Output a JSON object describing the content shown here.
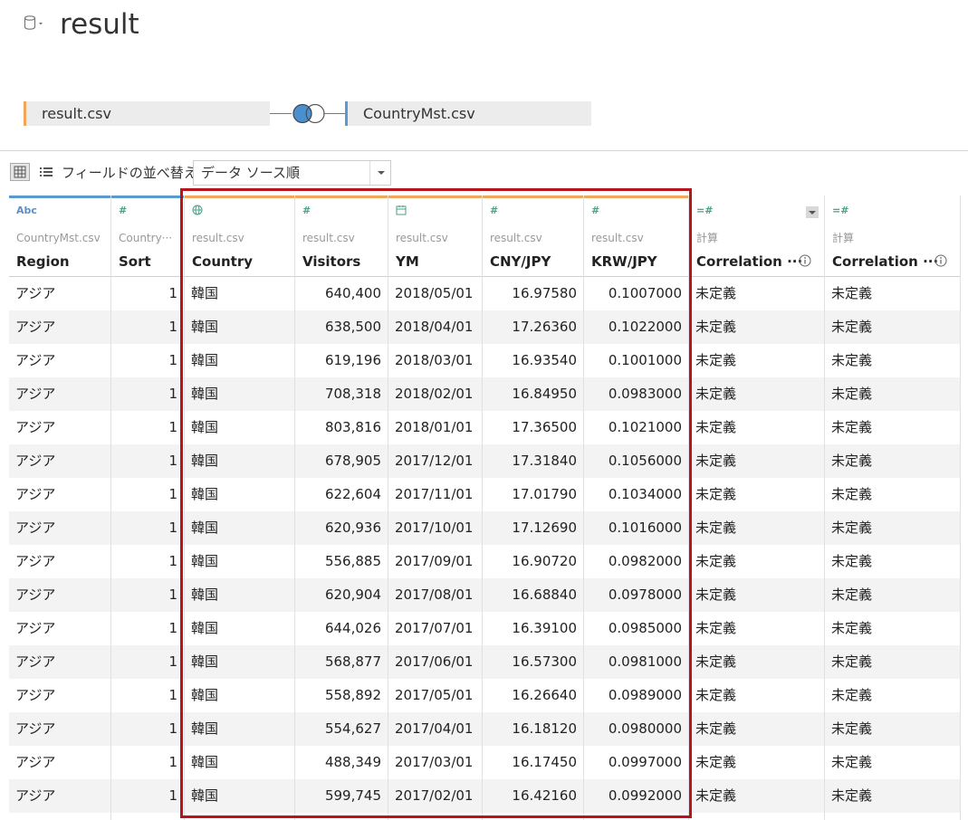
{
  "datasource": {
    "title": "result",
    "icon": "cylinder-db-icon"
  },
  "join": {
    "left_table": "result.csv",
    "right_table": "CountryMst.csv",
    "join_type": "left-join-icon"
  },
  "toolbar": {
    "sort_label": "フィールドの並べ替え",
    "sort_value": "データ ソース順"
  },
  "columns": [
    {
      "type_icon": "Abc",
      "source": "CountryMst.csv",
      "name": "Region"
    },
    {
      "type_icon": "#",
      "source": "Country···",
      "name": "Sort"
    },
    {
      "type_icon": "globe",
      "source": "result.csv",
      "name": "Country"
    },
    {
      "type_icon": "#",
      "source": "result.csv",
      "name": "Visitors"
    },
    {
      "type_icon": "calendar",
      "source": "result.csv",
      "name": "YM"
    },
    {
      "type_icon": "#",
      "source": "result.csv",
      "name": "CNY/JPY"
    },
    {
      "type_icon": "#",
      "source": "result.csv",
      "name": "KRW/JPY"
    },
    {
      "type_icon": "=#",
      "source": "計算",
      "name": "Correlation ···"
    },
    {
      "type_icon": "=#",
      "source": "計算",
      "name": "Correlation ···"
    }
  ],
  "rows": [
    [
      "アジア",
      "1",
      "韓国",
      "640,400",
      "2018/05/01",
      "16.97580",
      "0.1007000",
      "未定義",
      "未定義"
    ],
    [
      "アジア",
      "1",
      "韓国",
      "638,500",
      "2018/04/01",
      "17.26360",
      "0.1022000",
      "未定義",
      "未定義"
    ],
    [
      "アジア",
      "1",
      "韓国",
      "619,196",
      "2018/03/01",
      "16.93540",
      "0.1001000",
      "未定義",
      "未定義"
    ],
    [
      "アジア",
      "1",
      "韓国",
      "708,318",
      "2018/02/01",
      "16.84950",
      "0.0983000",
      "未定義",
      "未定義"
    ],
    [
      "アジア",
      "1",
      "韓国",
      "803,816",
      "2018/01/01",
      "17.36500",
      "0.1021000",
      "未定義",
      "未定義"
    ],
    [
      "アジア",
      "1",
      "韓国",
      "678,905",
      "2017/12/01",
      "17.31840",
      "0.1056000",
      "未定義",
      "未定義"
    ],
    [
      "アジア",
      "1",
      "韓国",
      "622,604",
      "2017/11/01",
      "17.01790",
      "0.1034000",
      "未定義",
      "未定義"
    ],
    [
      "アジア",
      "1",
      "韓国",
      "620,936",
      "2017/10/01",
      "17.12690",
      "0.1016000",
      "未定義",
      "未定義"
    ],
    [
      "アジア",
      "1",
      "韓国",
      "556,885",
      "2017/09/01",
      "16.90720",
      "0.0982000",
      "未定義",
      "未定義"
    ],
    [
      "アジア",
      "1",
      "韓国",
      "620,904",
      "2017/08/01",
      "16.68840",
      "0.0978000",
      "未定義",
      "未定義"
    ],
    [
      "アジア",
      "1",
      "韓国",
      "644,026",
      "2017/07/01",
      "16.39100",
      "0.0985000",
      "未定義",
      "未定義"
    ],
    [
      "アジア",
      "1",
      "韓国",
      "568,877",
      "2017/06/01",
      "16.57300",
      "0.0981000",
      "未定義",
      "未定義"
    ],
    [
      "アジア",
      "1",
      "韓国",
      "558,892",
      "2017/05/01",
      "16.26640",
      "0.0989000",
      "未定義",
      "未定義"
    ],
    [
      "アジア",
      "1",
      "韓国",
      "554,627",
      "2017/04/01",
      "16.18120",
      "0.0980000",
      "未定義",
      "未定義"
    ],
    [
      "アジア",
      "1",
      "韓国",
      "488,349",
      "2017/03/01",
      "16.17450",
      "0.0997000",
      "未定義",
      "未定義"
    ],
    [
      "アジア",
      "1",
      "韓国",
      "599,745",
      "2017/02/01",
      "16.42160",
      "0.0992000",
      "未定義",
      "未定義"
    ]
  ],
  "colors": {
    "left_accent": "#f2a65a",
    "right_accent": "#5b9ad0",
    "highlight": "#b8141c",
    "type_icon": "#4aa08a"
  }
}
